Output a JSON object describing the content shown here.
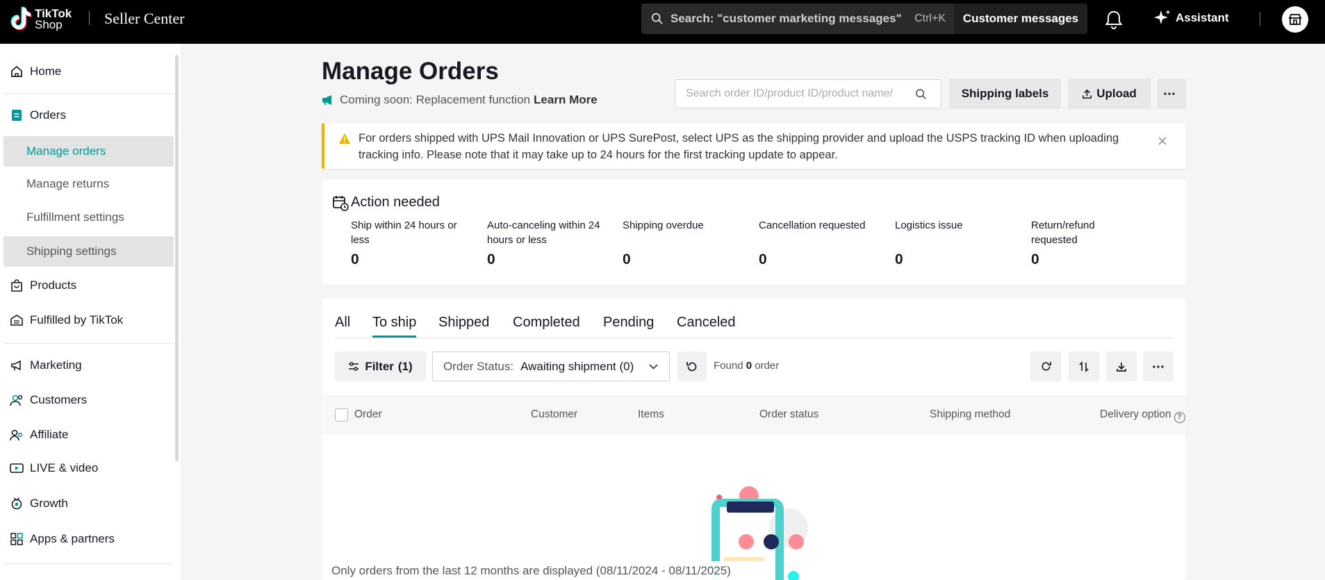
{
  "topbar": {
    "logo_line1": "TikTok",
    "logo_line2": "Shop",
    "product_name": "Seller Center",
    "search_text": "Search: \"customer marketing messages\"",
    "search_shortcut": "Ctrl+K",
    "customer_messages": "Customer messages",
    "assistant": "Assistant"
  },
  "sidebar": {
    "home": "Home",
    "orders": "Orders",
    "orders_sub": [
      "Manage orders",
      "Manage returns",
      "Fulfillment settings",
      "Shipping settings"
    ],
    "products": "Products",
    "fulfilled_by_tiktok": "Fulfilled by TikTok",
    "marketing": "Marketing",
    "customers": "Customers",
    "affiliate": "Affiliate",
    "live_video": "LIVE & video",
    "growth": "Growth",
    "apps_partners": "Apps & partners"
  },
  "header": {
    "title": "Manage Orders",
    "coming_soon": "Coming soon: Replacement function",
    "learn_more": "Learn More",
    "search_placeholder": "Search order ID/product ID/product name/",
    "shipping_labels": "Shipping labels",
    "upload": "Upload"
  },
  "notice": {
    "text": "For orders shipped with UPS Mail Innovation or UPS SurePost, select UPS as the shipping provider and upload the USPS tracking ID when uploading tracking info. Please note that it may take up to 24 hours for the first tracking update to appear."
  },
  "action_needed": {
    "title": "Action needed",
    "metrics": [
      {
        "label": "Ship within 24 hours or less",
        "value": "0"
      },
      {
        "label": "Auto-canceling within 24 hours or less",
        "value": "0"
      },
      {
        "label": "Shipping overdue",
        "value": "0"
      },
      {
        "label": "Cancellation requested",
        "value": "0"
      },
      {
        "label": "Logistics issue",
        "value": "0"
      },
      {
        "label": "Return/refund requested",
        "value": "0"
      }
    ]
  },
  "tabs": [
    "All",
    "To ship",
    "Shipped",
    "Completed",
    "Pending",
    "Canceled"
  ],
  "toolbar": {
    "filter_label": "Filter",
    "filter_count": "(1)",
    "status_label": "Order Status:",
    "status_value": "Awaiting shipment (0)",
    "found_prefix": "Found",
    "found_count": "0",
    "found_suffix": "order"
  },
  "table": {
    "columns": [
      "Order",
      "Customer",
      "Items",
      "Order status",
      "Shipping method",
      "Delivery option"
    ]
  },
  "footer_note": "Only orders from the last 12 months are displayed (08/11/2024 - 08/11/2025)",
  "colors": {
    "accent": "#009995",
    "warning": "#f0b400",
    "topbar": "#000000"
  }
}
